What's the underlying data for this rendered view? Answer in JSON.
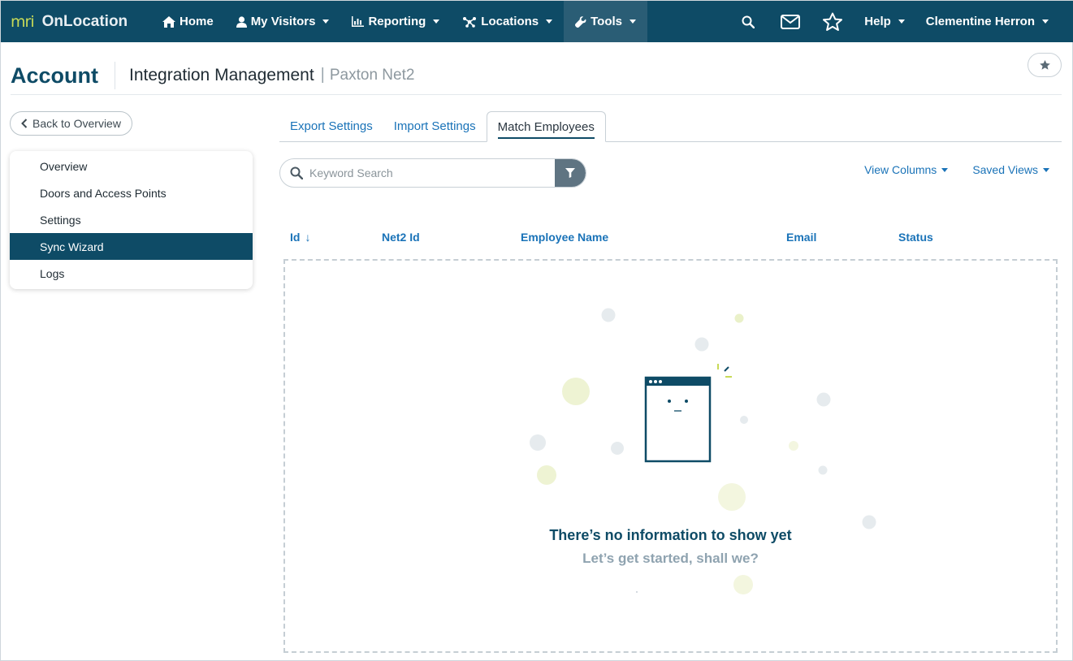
{
  "brand": {
    "logo_text": "mri",
    "name": "OnLocation"
  },
  "nav": {
    "items": [
      {
        "label": "Home",
        "icon": "home-icon"
      },
      {
        "label": "My Visitors",
        "icon": "user-icon"
      },
      {
        "label": "Reporting",
        "icon": "bar-chart-icon"
      },
      {
        "label": "Locations",
        "icon": "network-icon"
      },
      {
        "label": "Tools",
        "icon": "wrench-icon"
      }
    ],
    "active": "Tools",
    "help_label": "Help",
    "user_name": "Clementine Herron"
  },
  "header": {
    "title": "Account",
    "section": "Integration Management",
    "separator": "|",
    "subtitle": "Paxton Net2"
  },
  "sidebar": {
    "back_label": "Back to Overview",
    "items": [
      {
        "label": "Overview"
      },
      {
        "label": "Doors and Access Points"
      },
      {
        "label": "Settings"
      },
      {
        "label": "Sync Wizard"
      },
      {
        "label": "Logs"
      }
    ],
    "active": "Sync Wizard"
  },
  "tabs": [
    {
      "label": "Export Settings"
    },
    {
      "label": "Import Settings"
    },
    {
      "label": "Match Employees"
    }
  ],
  "active_tab": "Match Employees",
  "search": {
    "placeholder": "Keyword Search",
    "value": ""
  },
  "view_columns_label": "View Columns",
  "saved_views_label": "Saved Views",
  "table": {
    "columns": [
      {
        "label": "Id",
        "sort": "↓"
      },
      {
        "label": "Net2 Id"
      },
      {
        "label": "Employee Name"
      },
      {
        "label": "Email"
      },
      {
        "label": "Status"
      }
    ]
  },
  "empty_state": {
    "title": "There’s no information to show yet",
    "subtitle": "Let’s get started, shall we?"
  },
  "colors": {
    "nav_bg": "#0e4b66",
    "accent": "#1a73b8",
    "brand_green": "#c8da57",
    "muted": "#8fa3b0"
  }
}
